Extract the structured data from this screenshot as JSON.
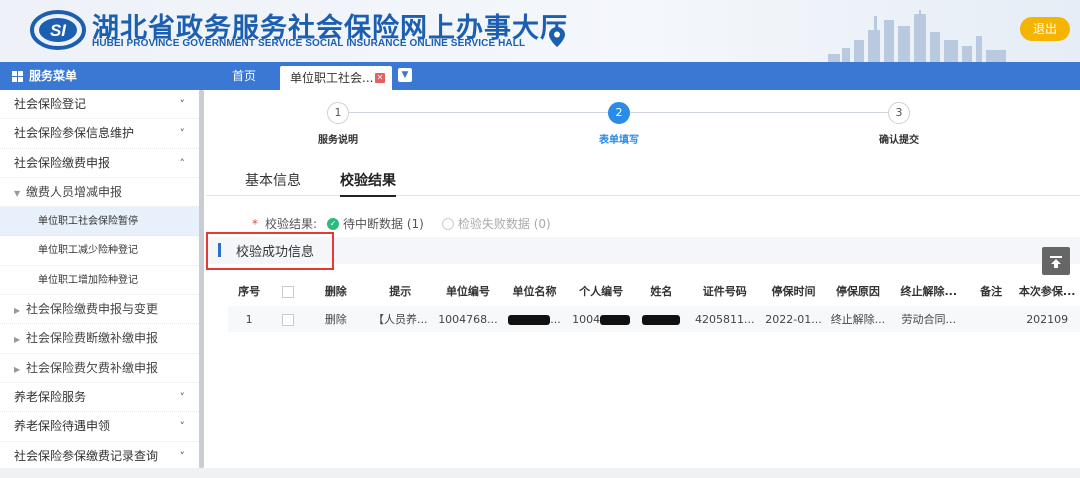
{
  "header": {
    "title": "湖北省政务服务社会保险网上办事大厅",
    "subtitle": "HUBEI PROVINCE GOVERNMENT SERVICE SOCIAL INSURANCE ONLINE SERVICE HALL",
    "logo_text": "SI",
    "logout_label": "退出",
    "accent": "#1c5fb0",
    "logout_color": "#f5b400"
  },
  "navbar": {
    "menu_title": "服务菜单",
    "home_tab": "首页",
    "active_tab": "单位职工社会..."
  },
  "sidebar": {
    "items": [
      {
        "label": "社会保险登记",
        "chevron": "˅"
      },
      {
        "label": "社会保险参保信息维护",
        "chevron": "˅"
      },
      {
        "label": "社会保险缴费申报",
        "chevron": "˄"
      },
      {
        "label": "缴费人员增减申报"
      },
      {
        "label": "单位职工社会保险暂停"
      },
      {
        "label": "单位职工减少险种登记"
      },
      {
        "label": "单位职工增加险种登记"
      },
      {
        "label": "社会保险缴费申报与变更"
      },
      {
        "label": "社会保险费断缴补缴申报"
      },
      {
        "label": "社会保险费欠费补缴申报"
      },
      {
        "label": "养老保险服务",
        "chevron": "˅"
      },
      {
        "label": "养老保险待遇申领",
        "chevron": "˅"
      },
      {
        "label": "社会保险参保缴费记录查询",
        "chevron": "˅"
      }
    ]
  },
  "steps": [
    {
      "num": "1",
      "label": "服务说明"
    },
    {
      "num": "2",
      "label": "表单填写"
    },
    {
      "num": "3",
      "label": "确认提交"
    }
  ],
  "sub_tabs": [
    "基本信息",
    "校验结果"
  ],
  "verify": {
    "label": "校验结果:",
    "option_on": "待中断数据 (1)",
    "option_off": "检验失败数据 (0)"
  },
  "section_title": "校验成功信息",
  "top_button_icon": "arrow-up-to-top-icon",
  "table": {
    "headers": [
      "序号",
      "",
      "删除",
      "提示",
      "单位编号",
      "单位名称",
      "个人编号",
      "姓名",
      "证件号码",
      "停保时间",
      "停保原因",
      "终止解除...",
      "备注",
      "本次参保..."
    ],
    "rows": [
      {
        "seq": "1",
        "del": "删除",
        "hint": "【人员养...",
        "unit_no": "1004768...",
        "unit_name": "...",
        "person_no": "1004",
        "name": "",
        "id_no": "4205811...",
        "stop_time": "2022-01...",
        "stop_reason": "终止解除...",
        "terminate": "劳动合同...",
        "remark": "",
        "period": "202109"
      }
    ]
  }
}
